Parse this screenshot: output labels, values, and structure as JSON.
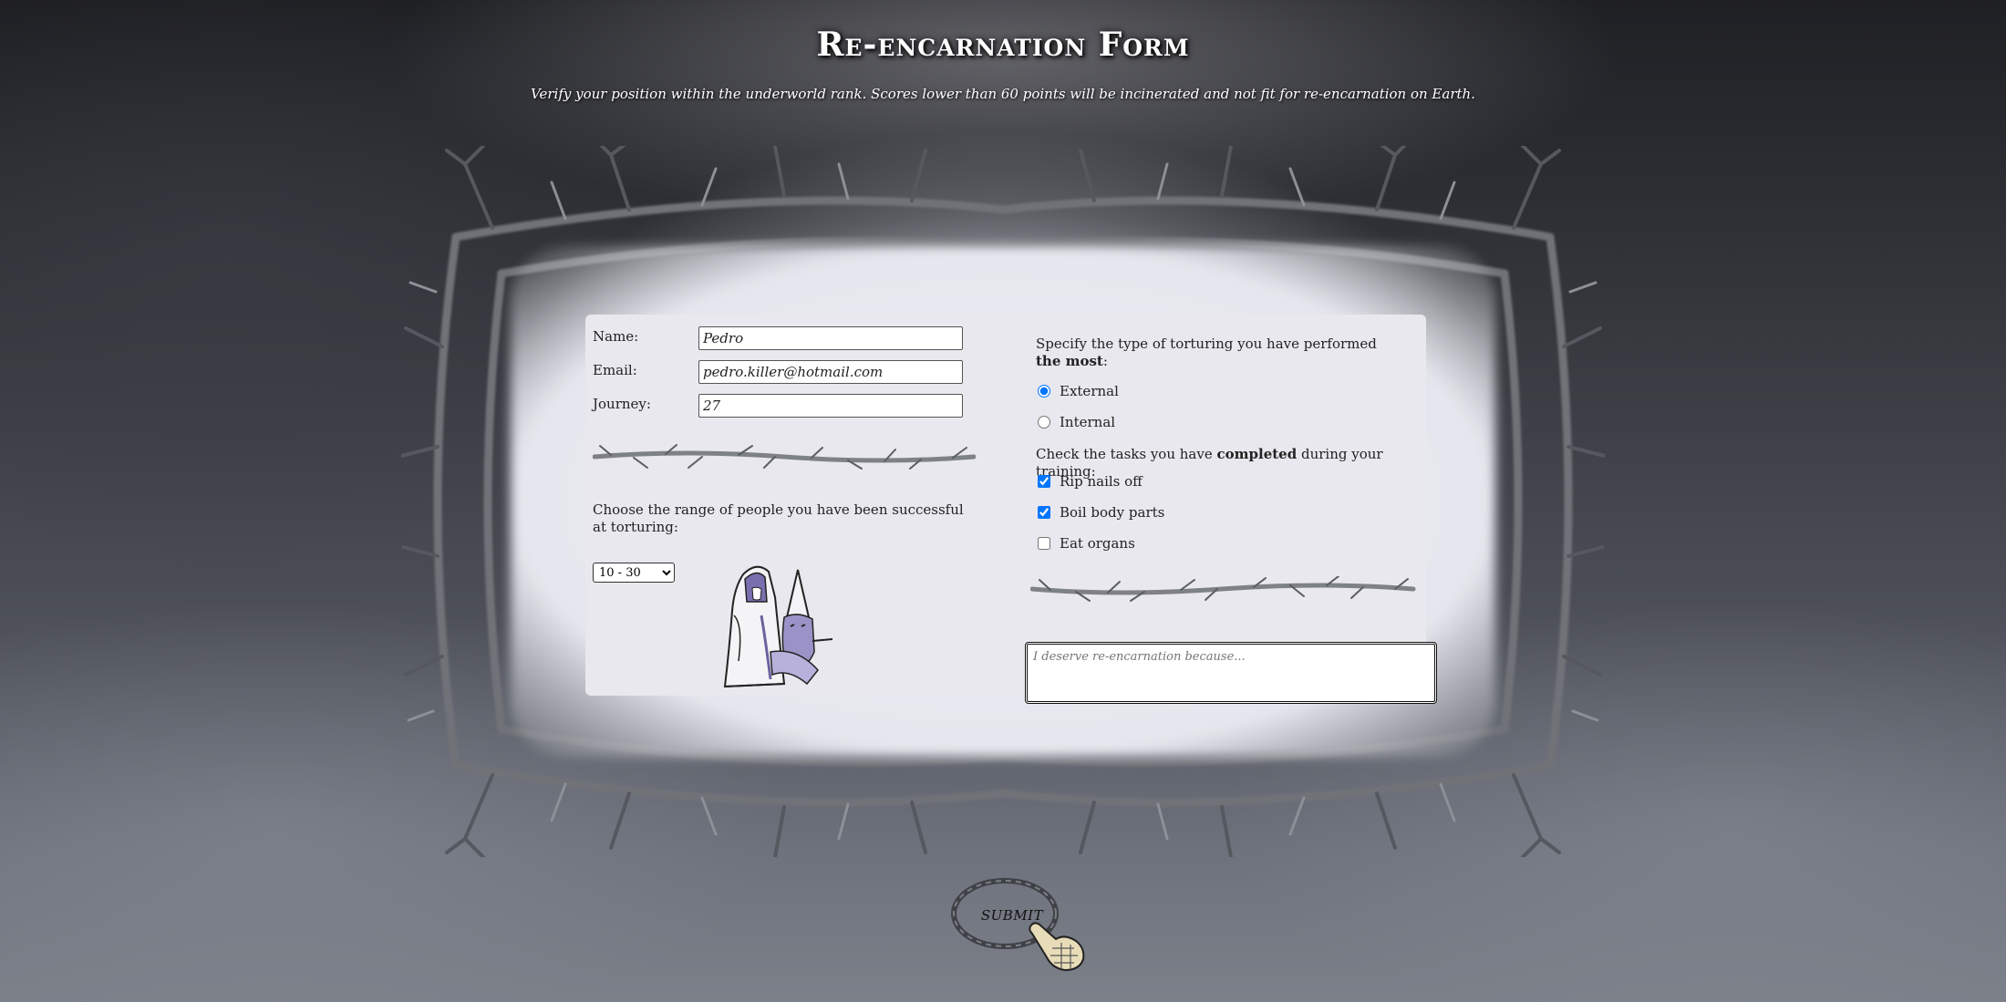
{
  "header": {
    "title": "Re-encarnation Form",
    "subtitle": "Verify your position within the underworld rank. Scores lower than 60 points will be incinerated and not fit for re-encarnation on Earth."
  },
  "form": {
    "name_label": "Name:",
    "name_value": "Pedro",
    "email_label": "Email:",
    "email_value": "pedro.killer@hotmail.com",
    "journey_label": "Journey:",
    "journey_value": "27",
    "range_prompt": "Choose the range of people you have been successful at torturing:",
    "range_selected": "10 - 30",
    "torture_prompt_start": "Specify the type of torturing you have performed ",
    "torture_prompt_bold": "the most",
    "torture_prompt_end": ":",
    "torture_options": [
      {
        "label": "External",
        "checked": true
      },
      {
        "label": "Internal",
        "checked": false
      }
    ],
    "tasks_prompt_start": "Check the tasks you have ",
    "tasks_prompt_bold": "completed",
    "tasks_prompt_end": " during your training:",
    "tasks": [
      {
        "label": "Rip nails off",
        "checked": true
      },
      {
        "label": "Boil body parts",
        "checked": true
      },
      {
        "label": "Eat organs",
        "checked": false
      }
    ],
    "reason_placeholder": "I deserve re-encarnation because..."
  },
  "submit": {
    "label": "SUBMIT"
  },
  "icons": {
    "frame": "thorny-branches-frame",
    "divider": "thorn-branch-divider",
    "illustration": "hooded-executioner-illustration",
    "pointer": "pointing-hand-icon"
  }
}
